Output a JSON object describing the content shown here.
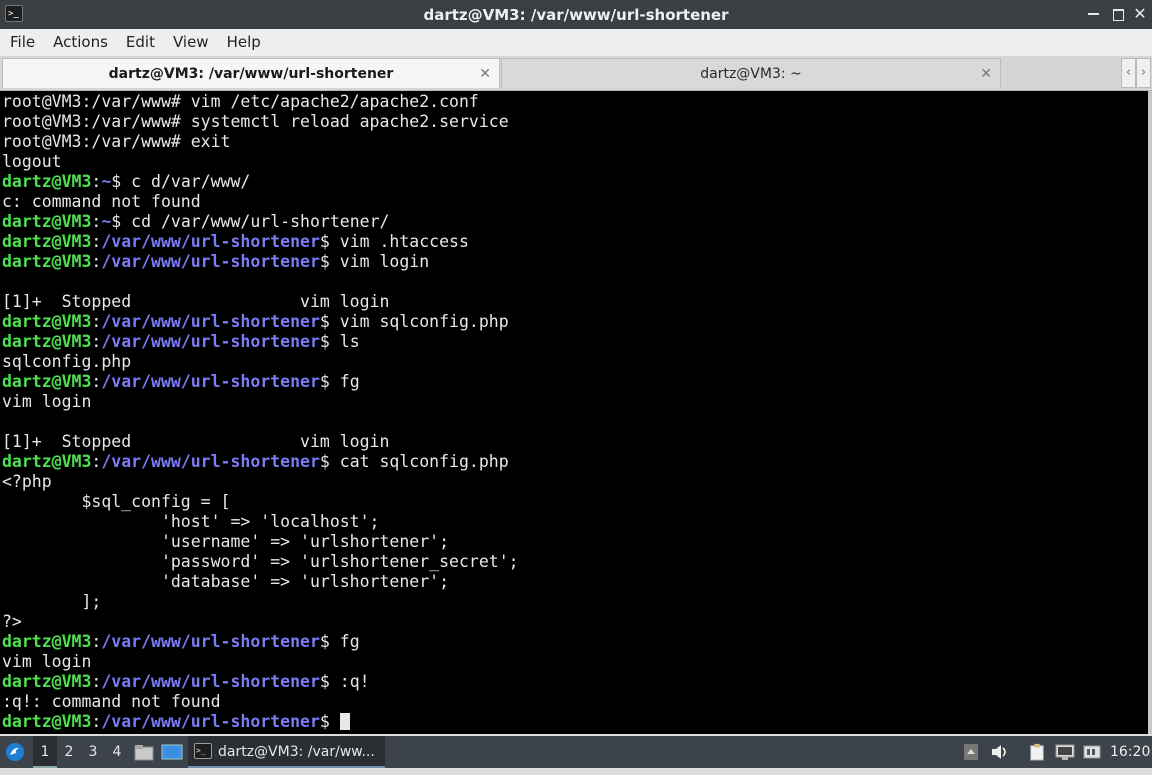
{
  "window": {
    "title": "dartz@VM3: /var/www/url-shortener",
    "app_icon": ">_"
  },
  "menubar": {
    "items": [
      "File",
      "Actions",
      "Edit",
      "View",
      "Help"
    ]
  },
  "tabs": [
    {
      "label": "dartz@VM3: /var/www/url-shortener",
      "active": true
    },
    {
      "label": "dartz@VM3: ~",
      "active": false
    }
  ],
  "terminal": {
    "lines": [
      {
        "t": "plain",
        "text": "root@VM3:/var/www# vim /etc/apache2/apache2.conf"
      },
      {
        "t": "plain",
        "text": "root@VM3:/var/www# systemctl reload apache2.service"
      },
      {
        "t": "plain",
        "text": "root@VM3:/var/www# exit"
      },
      {
        "t": "plain",
        "text": "logout"
      },
      {
        "t": "prompt",
        "user": "dartz@VM3",
        "path": "~",
        "cmd": "c d/var/www/"
      },
      {
        "t": "plain",
        "text": "c: command not found"
      },
      {
        "t": "prompt",
        "user": "dartz@VM3",
        "path": "~",
        "cmd": "cd /var/www/url-shortener/"
      },
      {
        "t": "prompt",
        "user": "dartz@VM3",
        "path": "/var/www/url-shortener",
        "cmd": "vim .htaccess"
      },
      {
        "t": "prompt",
        "user": "dartz@VM3",
        "path": "/var/www/url-shortener",
        "cmd": "vim login"
      },
      {
        "t": "plain",
        "text": ""
      },
      {
        "t": "plain",
        "text": "[1]+  Stopped                 vim login"
      },
      {
        "t": "prompt",
        "user": "dartz@VM3",
        "path": "/var/www/url-shortener",
        "cmd": "vim sqlconfig.php"
      },
      {
        "t": "prompt",
        "user": "dartz@VM3",
        "path": "/var/www/url-shortener",
        "cmd": "ls"
      },
      {
        "t": "plain",
        "text": "sqlconfig.php"
      },
      {
        "t": "prompt",
        "user": "dartz@VM3",
        "path": "/var/www/url-shortener",
        "cmd": "fg"
      },
      {
        "t": "plain",
        "text": "vim login"
      },
      {
        "t": "plain",
        "text": ""
      },
      {
        "t": "plain",
        "text": "[1]+  Stopped                 vim login"
      },
      {
        "t": "prompt",
        "user": "dartz@VM3",
        "path": "/var/www/url-shortener",
        "cmd": "cat sqlconfig.php"
      },
      {
        "t": "plain",
        "text": "<?php"
      },
      {
        "t": "plain",
        "text": "        $sql_config = ["
      },
      {
        "t": "plain",
        "text": "                'host' => 'localhost';"
      },
      {
        "t": "plain",
        "text": "                'username' => 'urlshortener';"
      },
      {
        "t": "plain",
        "text": "                'password' => 'urlshortener_secret';"
      },
      {
        "t": "plain",
        "text": "                'database' => 'urlshortener';"
      },
      {
        "t": "plain",
        "text": "        ];"
      },
      {
        "t": "plain",
        "text": "?>"
      },
      {
        "t": "prompt",
        "user": "dartz@VM3",
        "path": "/var/www/url-shortener",
        "cmd": "fg"
      },
      {
        "t": "plain",
        "text": "vim login"
      },
      {
        "t": "prompt",
        "user": "dartz@VM3",
        "path": "/var/www/url-shortener",
        "cmd": ":q!"
      },
      {
        "t": "plain",
        "text": ":q!: command not found"
      },
      {
        "t": "prompt",
        "user": "dartz@VM3",
        "path": "/var/www/url-shortener",
        "cmd": "",
        "cursor": true
      }
    ]
  },
  "taskbar": {
    "workspaces": [
      "1",
      "2",
      "3",
      "4"
    ],
    "active_workspace": "1",
    "task_label": "dartz@VM3: /var/ww...",
    "clock": "16:20",
    "icons": [
      "start-menu-icon",
      "file-manager-icon",
      "desktop-icon",
      "terminal-icon",
      "tray-up-icon",
      "volume-icon",
      "clipboard-icon",
      "display-icon",
      "network-icon"
    ]
  },
  "colors": {
    "titlebar_bg": "#3a3f44",
    "terminal_bg": "#000000",
    "prompt_user": "#4ee04e",
    "prompt_path": "#7b7bf5",
    "taskbar_bg": "#3d434a"
  }
}
